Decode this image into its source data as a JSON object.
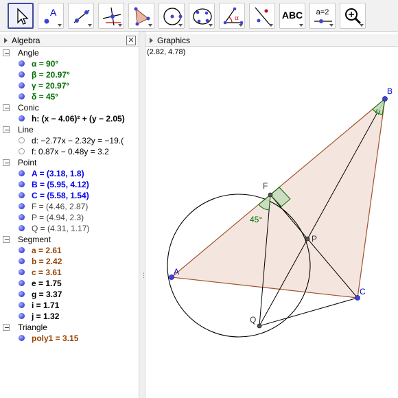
{
  "toolbar": {
    "tools": [
      {
        "name": "move-tool",
        "active": true
      },
      {
        "name": "new-point-tool",
        "label": "A"
      },
      {
        "name": "line-tool"
      },
      {
        "name": "perpendicular-line-tool"
      },
      {
        "name": "polygon-tool"
      },
      {
        "name": "circle-tool"
      },
      {
        "name": "conic-tool"
      },
      {
        "name": "angle-tool",
        "label": "α"
      },
      {
        "name": "reflect-tool"
      },
      {
        "name": "text-tool",
        "label": "ABC"
      },
      {
        "name": "slider-tool",
        "label": "a=2"
      },
      {
        "name": "zoom-tool"
      }
    ]
  },
  "algebra": {
    "title": "Algebra",
    "close_label": "✕",
    "categories": [
      {
        "label": "Angle",
        "items": [
          {
            "text": "α = 90°",
            "style": "angle",
            "visible": true
          },
          {
            "text": "β = 20.97°",
            "style": "angle",
            "visible": true
          },
          {
            "text": "γ = 20.97°",
            "style": "angle",
            "visible": true
          },
          {
            "text": "δ = 45°",
            "style": "angle",
            "visible": true
          }
        ]
      },
      {
        "label": "Conic",
        "items": [
          {
            "text": "h: (x − 4.06)² + (y − 2.05)",
            "style": "conic",
            "visible": true
          }
        ]
      },
      {
        "label": "Line",
        "items": [
          {
            "text": "d: −2.77x − 2.32y = −19.(",
            "style": "line",
            "visible": false
          },
          {
            "text": "f: 0.87x − 0.48y = 3.2",
            "style": "line",
            "visible": false
          }
        ]
      },
      {
        "label": "Point",
        "items": [
          {
            "text": "A = (3.18, 1.8)",
            "style": "blue",
            "visible": true
          },
          {
            "text": "B = (5.95, 4.12)",
            "style": "blue",
            "visible": true
          },
          {
            "text": "C = (5.58, 1.54)",
            "style": "blue",
            "visible": true
          },
          {
            "text": "F = (4.46, 2.87)",
            "style": "gray",
            "visible": true
          },
          {
            "text": "P = (4.94, 2.3)",
            "style": "gray",
            "visible": true
          },
          {
            "text": "Q = (4.31, 1.17)",
            "style": "gray",
            "visible": true
          }
        ]
      },
      {
        "label": "Segment",
        "items": [
          {
            "text": "a = 2.61",
            "style": "brown",
            "visible": true
          },
          {
            "text": "b = 2.42",
            "style": "brown",
            "visible": true
          },
          {
            "text": "c = 3.61",
            "style": "brown",
            "visible": true
          },
          {
            "text": "e = 1.75",
            "style": "black",
            "visible": true
          },
          {
            "text": "g = 3.37",
            "style": "black",
            "visible": true
          },
          {
            "text": "i = 1.71",
            "style": "black",
            "visible": true
          },
          {
            "text": "j = 1.32",
            "style": "black",
            "visible": true
          }
        ]
      },
      {
        "label": "Triangle",
        "items": [
          {
            "text": "poly1 = 3.15",
            "style": "brown",
            "visible": true
          }
        ]
      }
    ]
  },
  "graphics": {
    "title": "Graphics",
    "coords": "(2.82, 4.78)",
    "points": {
      "A": "A",
      "B": "B",
      "C": "C",
      "F": "F",
      "P": "P",
      "Q": "Q"
    },
    "angle_label": "45°"
  },
  "colors": {
    "point": "#3d43d8",
    "triangle_fill": "#f3e4dd",
    "triangle_edge": "#a0522d",
    "angle_green": "#007000",
    "angle_fill": "#c9d9bf"
  }
}
